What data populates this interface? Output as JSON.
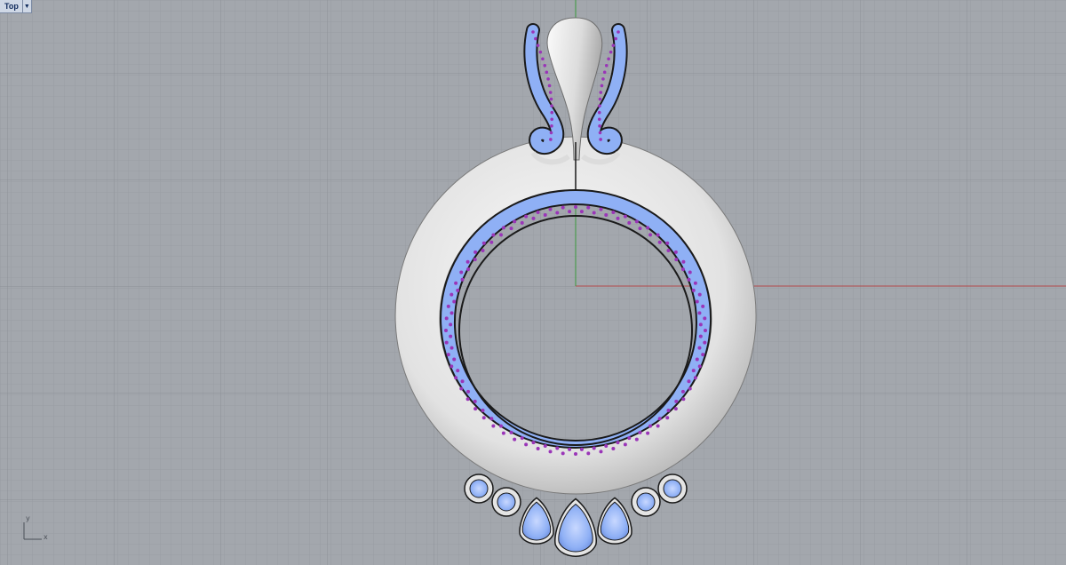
{
  "viewport": {
    "label": "Top",
    "dropdown_icon": "triangle-down-icon"
  },
  "axis_indicator": {
    "y_label": "y",
    "x_label": "x"
  },
  "colors": {
    "background": "#a3a7ad",
    "grid_minor": "#979ba2",
    "grid_major": "#8a8f96",
    "x_axis": "#b34a4a",
    "y_axis": "#3a9a3a",
    "metal_light": "#f4f4f4",
    "metal_dark": "#a9a9a9",
    "gem_blue": "#8fb0f5",
    "bead_purple": "#9a35b8"
  },
  "model": {
    "name": "circle-pendant",
    "gem_bezels_count": 7
  }
}
